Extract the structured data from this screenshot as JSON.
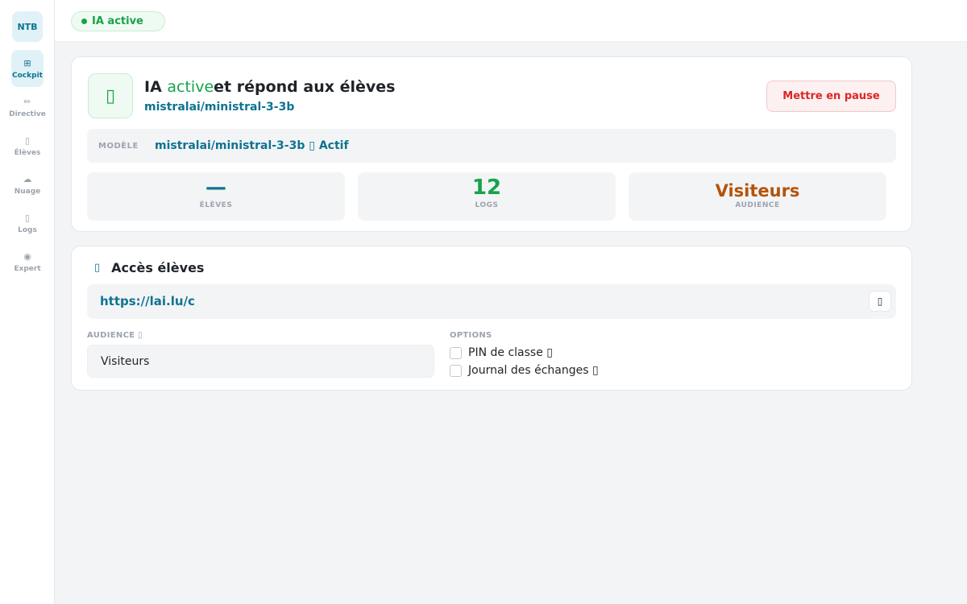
{
  "sidebar": {
    "logo": "NTB",
    "items": [
      {
        "icon": "⊞",
        "label": "Cockpit"
      },
      {
        "icon": "✏",
        "label": "Directive"
      },
      {
        "icon": "▯",
        "label": "Élèves"
      },
      {
        "icon": "☁",
        "label": "Nuage"
      },
      {
        "icon": "▯",
        "label": "Logs"
      },
      {
        "icon": "◉",
        "label": "Expert"
      }
    ]
  },
  "topbar": {
    "status": "IA active"
  },
  "status_card": {
    "icon": "▯",
    "headline_prefix": "IA ",
    "headline_active": "active",
    "headline_suffix": "et répond aux élèves",
    "model_name": "mistralai/ministral-3-3b",
    "pause_button": "Mettre en pause",
    "model_row_label": "MODÈLE",
    "model_row_value": "mistralai/ministral-3-3b ▯ Actif",
    "stats": [
      {
        "value": "—",
        "label": "ÉLÈVES"
      },
      {
        "value": "12",
        "label": "LOGS"
      },
      {
        "value": "Visiteurs",
        "label": "AUDIENCE"
      }
    ]
  },
  "access_card": {
    "icon": "▯",
    "title": "Accès élèves",
    "url": "https://lai.lu/c",
    "copy_icon": "▯",
    "audience_label": "AUDIENCE ▯",
    "audience_value": "Visiteurs",
    "options_label": "OPTIONS",
    "options": [
      {
        "label": "PIN de classe ▯",
        "checked": false
      },
      {
        "label": "Journal des échanges ▯",
        "checked": false
      }
    ]
  },
  "colors": {
    "accent": "#0e7490",
    "success": "#16a34a",
    "danger": "#dc2626",
    "warning": "#b45309"
  }
}
